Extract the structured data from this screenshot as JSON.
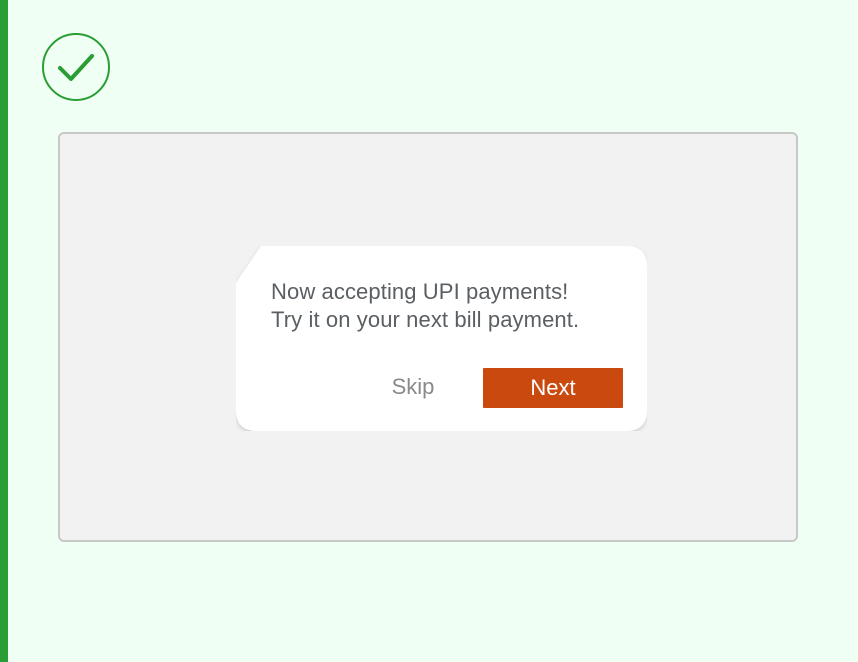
{
  "status": {
    "icon": "checkmark-circle-icon",
    "color": "#2a9d35"
  },
  "tooltip": {
    "line1": "Now accepting UPI payments!",
    "line2": "Try it on your next bill payment.",
    "skip_label": "Skip",
    "next_label": "Next"
  },
  "colors": {
    "accent_bar": "#2a9d35",
    "page_background": "#f0fff4",
    "stage_background": "#f2f2f2",
    "primary_button": "#c9490f",
    "text": "#5a5f63"
  }
}
